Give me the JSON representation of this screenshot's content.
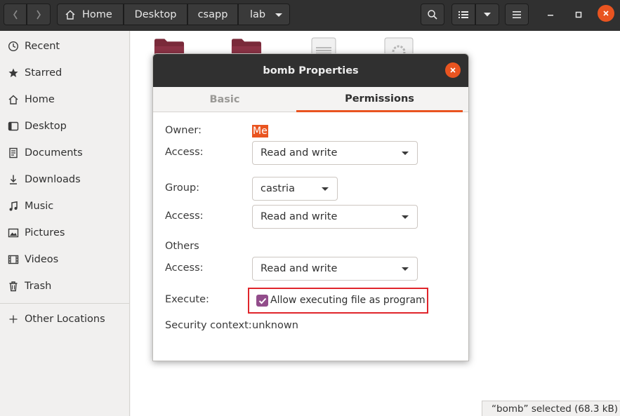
{
  "header": {
    "breadcrumbs": [
      "Home",
      "Desktop",
      "csapp",
      "lab"
    ],
    "icons": {
      "back": "chevron-left-icon",
      "forward": "chevron-right-icon",
      "home": "home-icon",
      "search": "search-icon",
      "view": "list-view-icon",
      "view_options": "chevron-down-icon",
      "menu": "hamburger-menu-icon",
      "minimize": "minimize-icon",
      "maximize": "maximize-icon",
      "close": "close-icon"
    }
  },
  "sidebar": {
    "items": [
      {
        "label": "Recent",
        "icon": "clock-icon"
      },
      {
        "label": "Starred",
        "icon": "star-icon"
      },
      {
        "label": "Home",
        "icon": "home-icon"
      },
      {
        "label": "Desktop",
        "icon": "desktop-icon"
      },
      {
        "label": "Documents",
        "icon": "document-icon"
      },
      {
        "label": "Downloads",
        "icon": "download-icon"
      },
      {
        "label": "Music",
        "icon": "music-icon"
      },
      {
        "label": "Pictures",
        "icon": "picture-icon"
      },
      {
        "label": "Videos",
        "icon": "video-icon"
      },
      {
        "label": "Trash",
        "icon": "trash-icon"
      }
    ],
    "other_locations": {
      "label": "Other Locations",
      "icon": "plus-icon"
    }
  },
  "statusbar": {
    "text": "“bomb” selected  (68.3 kB)"
  },
  "dialog": {
    "title": "bomb Properties",
    "tabs": [
      "Basic",
      "Permissions"
    ],
    "active_tab": "Permissions",
    "owner": {
      "label": "Owner:",
      "value": "Me",
      "access_label": "Access:",
      "access": "Read and write"
    },
    "group": {
      "label": "Group:",
      "value": "castria",
      "access_label": "Access:",
      "access": "Read and write"
    },
    "others": {
      "label": "Others",
      "access_label": "Access:",
      "access": "Read and write"
    },
    "execute": {
      "label": "Execute:",
      "checkbox_label": "Allow executing file as program",
      "checked": true
    },
    "security": {
      "label": "Security context:",
      "value": "unknown"
    }
  },
  "colors": {
    "accent": "#e95420",
    "checkbox": "#924d8b",
    "highlight_box": "#e0252b",
    "headerbar": "#303030"
  }
}
